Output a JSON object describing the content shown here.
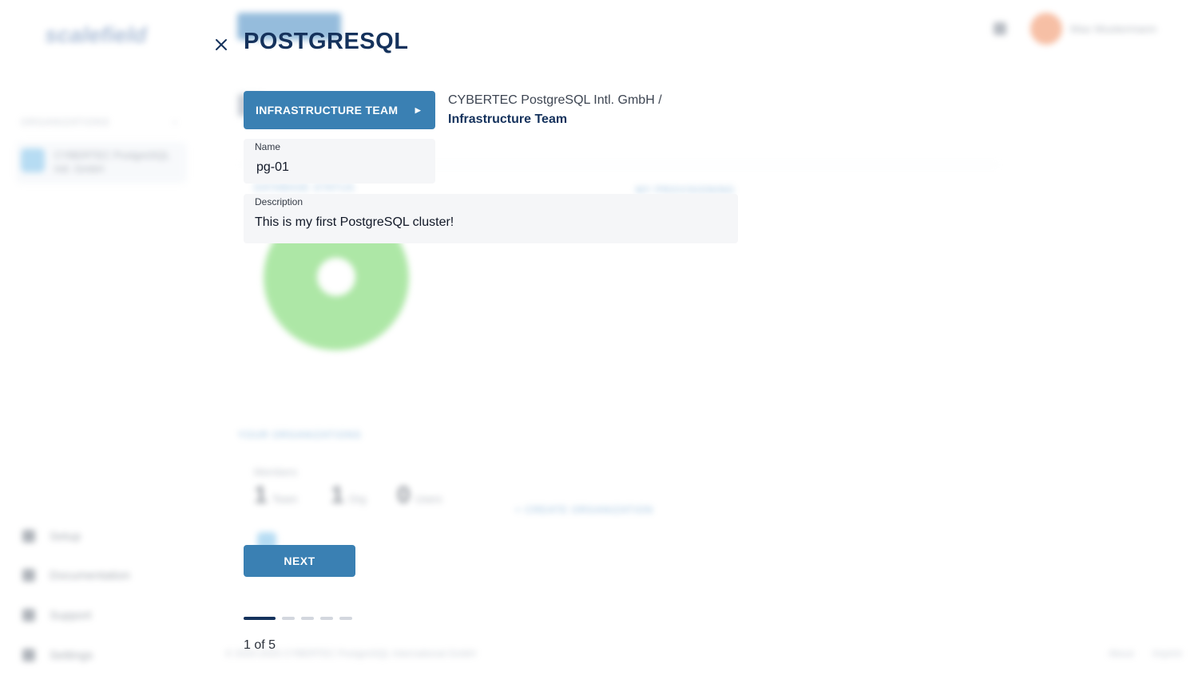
{
  "tour": {
    "title": "POSTGRESQL",
    "team_button_label": "INFRASTRUCTURE TEAM",
    "breadcrumb": {
      "organization": "CYBERTEC PostgreSQL Intl. GmbH /",
      "team": "Infrastructure Team"
    },
    "name_field": {
      "label": "Name",
      "value": "pg-01"
    },
    "description_field": {
      "label": "Description",
      "value": "This is my first PostgreSQL cluster!"
    },
    "next_label": "NEXT",
    "step_counter": "1 of 5",
    "steps_total": 5,
    "current_step": 1
  },
  "background": {
    "logo": "scalefield",
    "organizations_heading": "ORGANIZATIONS",
    "org_name": "CYBERTEC PostgreSQL Intl. GmbH",
    "nav": [
      "Setup",
      "Documentation",
      "Support",
      "Settings"
    ],
    "user_name": "Max Mustermann",
    "link_left": "DATABASE STATUS",
    "link_right": "MY PROVISIONING",
    "link_orgs": "YOUR ORGANIZATIONS",
    "members_label": "Members",
    "stats": [
      {
        "value": "1",
        "unit": "Team"
      },
      {
        "value": "1",
        "unit": "Org"
      },
      {
        "value": "0",
        "unit": "Users"
      }
    ],
    "link_create_org": "+ CREATE ORGANIZATION",
    "footer_left": "© 2020-2025 CYBERTEC PostgreSQL International GmbH",
    "footer_about": "About",
    "footer_imprint": "Imprint"
  },
  "colors": {
    "primary": "#3a80b3",
    "title": "#15325c",
    "donut": "#6bd45e"
  }
}
